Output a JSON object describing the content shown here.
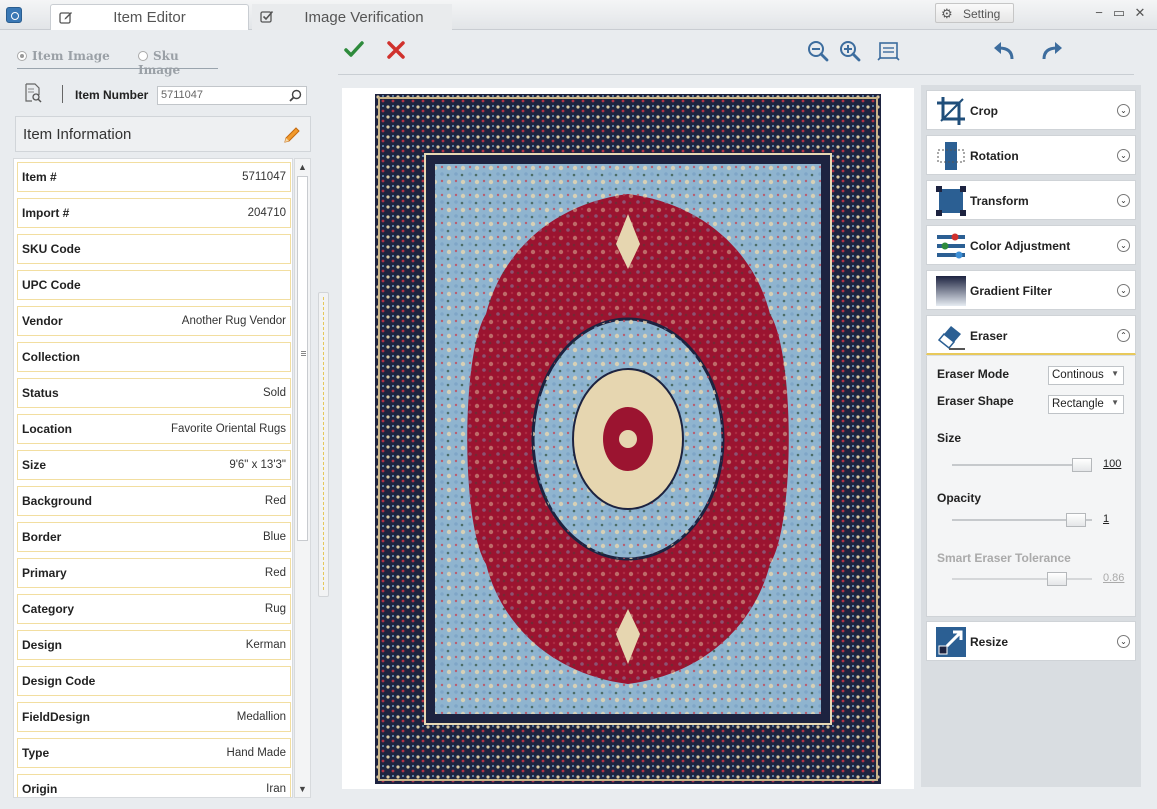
{
  "titlebar": {
    "tabs": [
      {
        "label": "Item Editor",
        "icon": "edit-icon",
        "active": true
      },
      {
        "label": "Image Verification",
        "icon": "checkbox-icon",
        "active": false
      }
    ],
    "setting_label": "Setting",
    "controls": {
      "minimize": "−",
      "maximize": "▭",
      "close": "✕"
    }
  },
  "image_source": {
    "options": [
      {
        "label": "Item Image",
        "selected": true
      },
      {
        "label": "Sku Image",
        "selected": false
      }
    ]
  },
  "search": {
    "label": "Item Number",
    "value": "5711047"
  },
  "item_info": {
    "title": "Item Information",
    "fields": [
      {
        "label": "Item #",
        "value": "5711047"
      },
      {
        "label": "Import #",
        "value": "204710"
      },
      {
        "label": "SKU Code",
        "value": ""
      },
      {
        "label": "UPC Code",
        "value": ""
      },
      {
        "label": "Vendor",
        "value": "Another Rug Vendor"
      },
      {
        "label": "Collection",
        "value": ""
      },
      {
        "label": "Status",
        "value": "Sold"
      },
      {
        "label": "Location",
        "value": "Favorite Oriental Rugs"
      },
      {
        "label": "Size",
        "value": "9'6\" x 13'3\""
      },
      {
        "label": "Background",
        "value": "Red"
      },
      {
        "label": "Border",
        "value": "Blue"
      },
      {
        "label": "Primary",
        "value": "Red"
      },
      {
        "label": "Category",
        "value": "Rug"
      },
      {
        "label": "Design",
        "value": "Kerman"
      },
      {
        "label": "Design Code",
        "value": ""
      },
      {
        "label": "FieldDesign",
        "value": "Medallion"
      },
      {
        "label": "Type",
        "value": "Hand Made"
      },
      {
        "label": "Origin",
        "value": "Iran"
      }
    ]
  },
  "toolbar": {
    "accept_icon": "check-icon",
    "reject_icon": "x-icon",
    "tools": [
      "zoom-out-icon",
      "zoom-in-icon",
      "fit-page-icon",
      "undo-icon",
      "redo-icon"
    ]
  },
  "tools_panel": {
    "sections": [
      {
        "label": "Crop",
        "icon": "crop-icon",
        "expanded": false
      },
      {
        "label": "Rotation",
        "icon": "rotation-icon",
        "expanded": false
      },
      {
        "label": "Transform",
        "icon": "transform-icon",
        "expanded": false
      },
      {
        "label": "Color Adjustment",
        "icon": "color-adjustment-icon",
        "expanded": false
      },
      {
        "label": "Gradient Filter",
        "icon": "gradient-filter-icon",
        "expanded": false
      },
      {
        "label": "Eraser",
        "icon": "eraser-icon",
        "expanded": true
      },
      {
        "label": "Resize",
        "icon": "resize-icon",
        "expanded": false
      }
    ],
    "eraser": {
      "mode_label": "Eraser Mode",
      "mode_value": "Continous",
      "shape_label": "Eraser Shape",
      "shape_value": "Rectangle",
      "size_label": "Size",
      "size_value": "100",
      "opacity_label": "Opacity",
      "opacity_value": "1",
      "tolerance_label": "Smart Eraser Tolerance",
      "tolerance_value": "0.86"
    }
  },
  "colors": {
    "accent_green": "#2e8b3c",
    "accent_red": "#d0312d",
    "toolbar_blue": "#3d6d9e",
    "highlight_yellow": "#e8c95b",
    "rug_field": "#9b1430",
    "rug_border": "#1d2340",
    "rug_blue": "#8fb4cf"
  }
}
